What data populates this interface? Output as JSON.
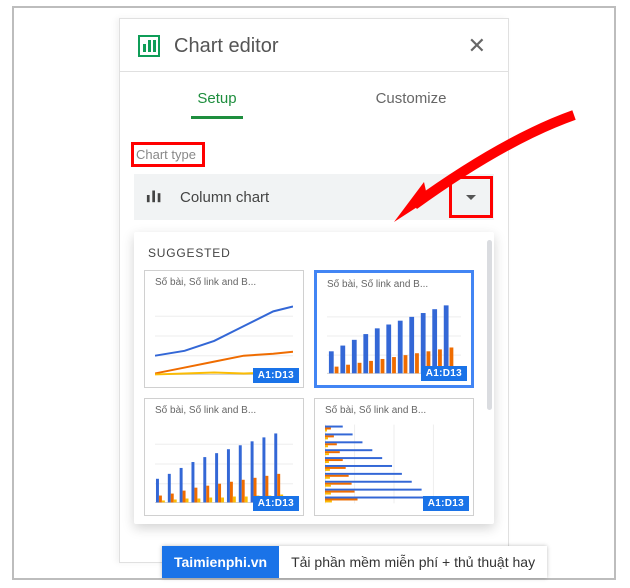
{
  "header": {
    "title": "Chart editor"
  },
  "tabs": [
    {
      "label": "Setup",
      "active": true
    },
    {
      "label": "Customize",
      "active": false
    }
  ],
  "chart_type": {
    "label": "Chart type",
    "selected": "Column chart"
  },
  "suggested": {
    "label": "SUGGESTED",
    "items": [
      {
        "title": "Số bài, Số link  and B...",
        "badge": "A1:D13",
        "kind": "line",
        "selected": false
      },
      {
        "title": "Số bài, Số link  and B...",
        "badge": "A1:D13",
        "kind": "column-single",
        "selected": true
      },
      {
        "title": "Số bài, Số link  and B...",
        "badge": "A1:D13",
        "kind": "column-grouped",
        "selected": false
      },
      {
        "title": "Số bài, Số link  and B...",
        "badge": "A1:D13",
        "kind": "bar",
        "selected": false
      }
    ]
  },
  "watermark": {
    "brand": "Taimienphi.vn",
    "tagline": "Tải phần mềm miễn phí + thủ thuật hay"
  }
}
